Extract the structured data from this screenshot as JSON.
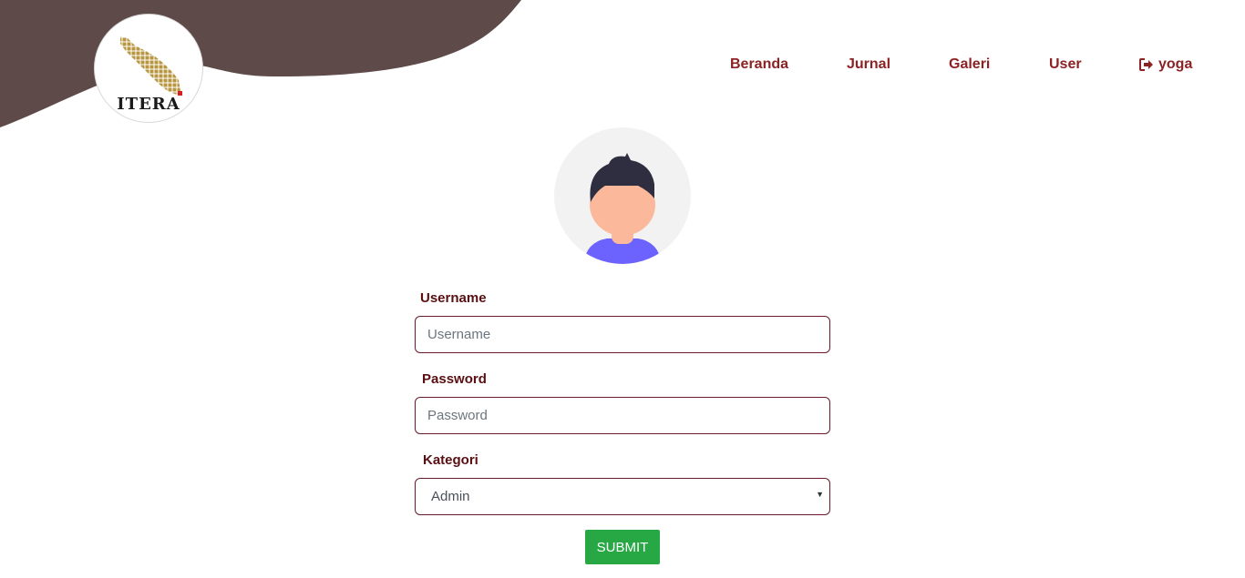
{
  "brand": {
    "logo_text": "ITERA",
    "wave_color": "#5e4a49",
    "logo_gold": "#b8963f"
  },
  "nav": {
    "items": [
      "Beranda",
      "Jurnal",
      "Galeri",
      "User"
    ],
    "user_label": "yoga",
    "user_icon": "sign-out-icon",
    "color": "#8b2224"
  },
  "form": {
    "username_label": "Username",
    "username_placeholder": "Username",
    "password_label": "Password",
    "password_placeholder": "Password",
    "kategori_label": "Kategori",
    "kategori_value": "Admin",
    "submit_label": "SUBMIT",
    "border_color": "#6b1a2a",
    "submit_color": "#28a745"
  }
}
